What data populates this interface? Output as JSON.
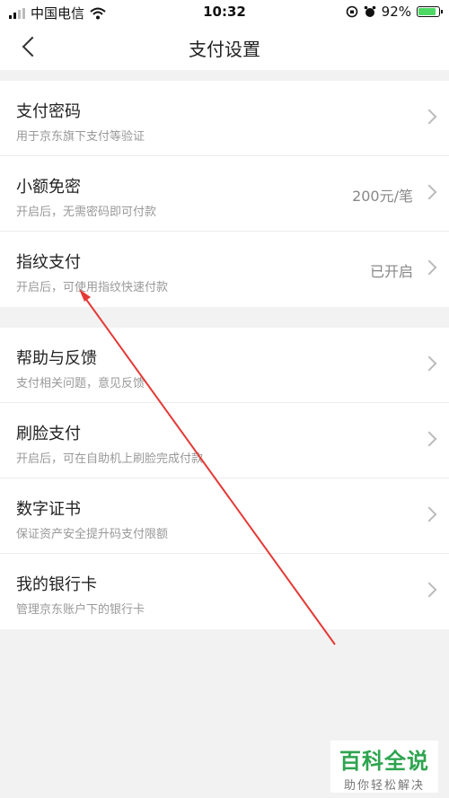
{
  "status_bar": {
    "carrier": "中国电信",
    "time": "10:32",
    "battery_percent": "92%",
    "battery_level": 0.92,
    "icons": [
      "signal-icon",
      "wifi-icon",
      "orientation-lock-icon",
      "alarm-icon",
      "battery-icon"
    ]
  },
  "nav": {
    "title": "支付设置",
    "back_icon": "back-icon"
  },
  "groups": [
    {
      "items": [
        {
          "title": "支付密码",
          "subtitle": "用于京东旗下支付等验证",
          "value": ""
        },
        {
          "title": "小额免密",
          "subtitle": "开启后，无需密码即可付款",
          "value": "200元/笔"
        },
        {
          "title": "指纹支付",
          "subtitle": "开启后，可使用指纹快速付款",
          "value": "已开启"
        }
      ]
    },
    {
      "items": [
        {
          "title": "帮助与反馈",
          "subtitle": "支付相关问题，意见反馈",
          "value": ""
        },
        {
          "title": "刷脸支付",
          "subtitle": "开启后，可在自助机上刷脸完成付款",
          "value": ""
        },
        {
          "title": "数字证书",
          "subtitle": "保证资产安全提升码支付限额",
          "value": ""
        },
        {
          "title": "我的银行卡",
          "subtitle": "管理京东账户下的银行卡",
          "value": ""
        }
      ]
    }
  ],
  "watermark": {
    "main": "百科全说",
    "sub": "助你轻松解决"
  },
  "colors": {
    "accent_arrow": "#e53935",
    "watermark_green": "#2ea44f",
    "battery_green": "#4cd964"
  }
}
